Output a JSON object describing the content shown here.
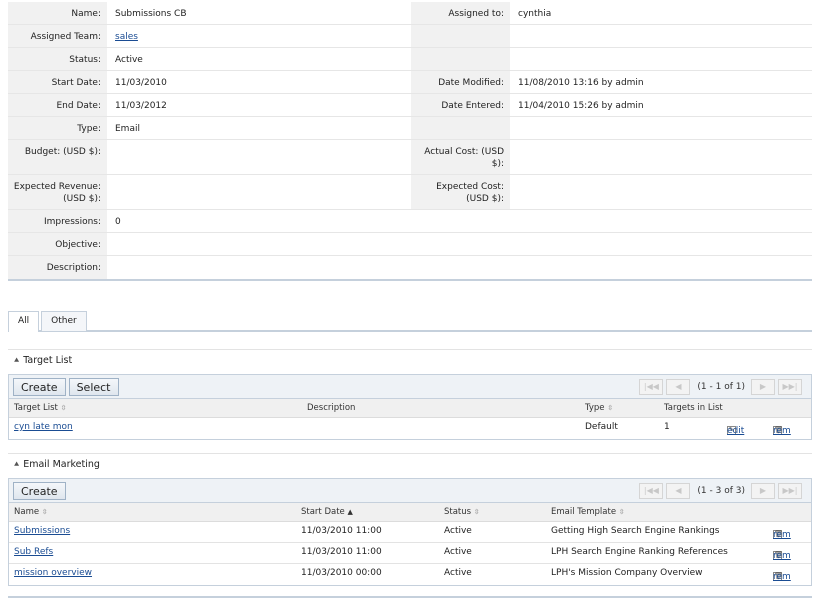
{
  "detail": {
    "rows": [
      {
        "l1": "Name:",
        "v1": "Submissions CB",
        "l2": "Assigned to:",
        "v2": "cynthia"
      },
      {
        "l1": "Assigned Team:",
        "v1": "sales",
        "l2": "",
        "v2": ""
      },
      {
        "l1": "Status:",
        "v1": "Active",
        "l2": "",
        "v2": ""
      },
      {
        "l1": "Start Date:",
        "v1": "11/03/2010",
        "l2": "Date Modified:",
        "v2": "11/08/2010 13:16 by admin"
      },
      {
        "l1": "End Date:",
        "v1": "11/03/2012",
        "l2": "Date Entered:",
        "v2": "11/04/2010 15:26 by admin"
      },
      {
        "l1": "Type:",
        "v1": "Email",
        "l2": "",
        "v2": ""
      },
      {
        "l1": "Budget: (USD $):",
        "v1": "",
        "l2": "Actual Cost: (USD $):",
        "v2": ""
      },
      {
        "l1": "Expected Revenue: (USD $):",
        "v1": "",
        "l2": "Expected Cost: (USD $):",
        "v2": ""
      },
      {
        "l1": "Impressions:",
        "v1": "0"
      },
      {
        "l1": "Objective:",
        "v1": ""
      },
      {
        "l1": "Description:",
        "v1": ""
      }
    ]
  },
  "tabs": [
    {
      "label": "All"
    },
    {
      "label": "Other"
    }
  ],
  "target_list": {
    "title": "Target List",
    "create_label": "Create",
    "select_label": "Select",
    "count": "(1 - 1 of 1)",
    "columns": [
      "Target List",
      "Description",
      "Type",
      "Targets in List"
    ],
    "rows": [
      {
        "name": "cyn late mon",
        "description": "",
        "type": "Default",
        "targets": "1",
        "edit": "edit",
        "rem": "rem"
      }
    ]
  },
  "email_marketing": {
    "title": "Email Marketing",
    "create_label": "Create",
    "count": "(1 - 3 of 3)",
    "columns": [
      "Name",
      "Start Date",
      "Status",
      "Email Template"
    ],
    "rows": [
      {
        "name": "Submissions",
        "start": "11/03/2010 11:00",
        "status": "Active",
        "template": "Getting High Search Engine Rankings",
        "rem": "rem"
      },
      {
        "name": "Sub Refs",
        "start": "11/03/2010 11:00",
        "status": "Active",
        "template": "LPH Search Engine Ranking References",
        "rem": "rem"
      },
      {
        "name": "mission overview",
        "start": "11/03/2010 00:00",
        "status": "Active",
        "template": "LPH's Mission Company Overview",
        "rem": "rem"
      }
    ]
  },
  "icons": {
    "collapse": "double-chevron-up-icon",
    "sort": "sort-arrows-icon",
    "edit": "pencil-icon",
    "remove": "trash-icon"
  },
  "colors": {
    "link": "#1a4c93",
    "label_bg": "#f1f1f1",
    "border": "#c5d0dc"
  }
}
